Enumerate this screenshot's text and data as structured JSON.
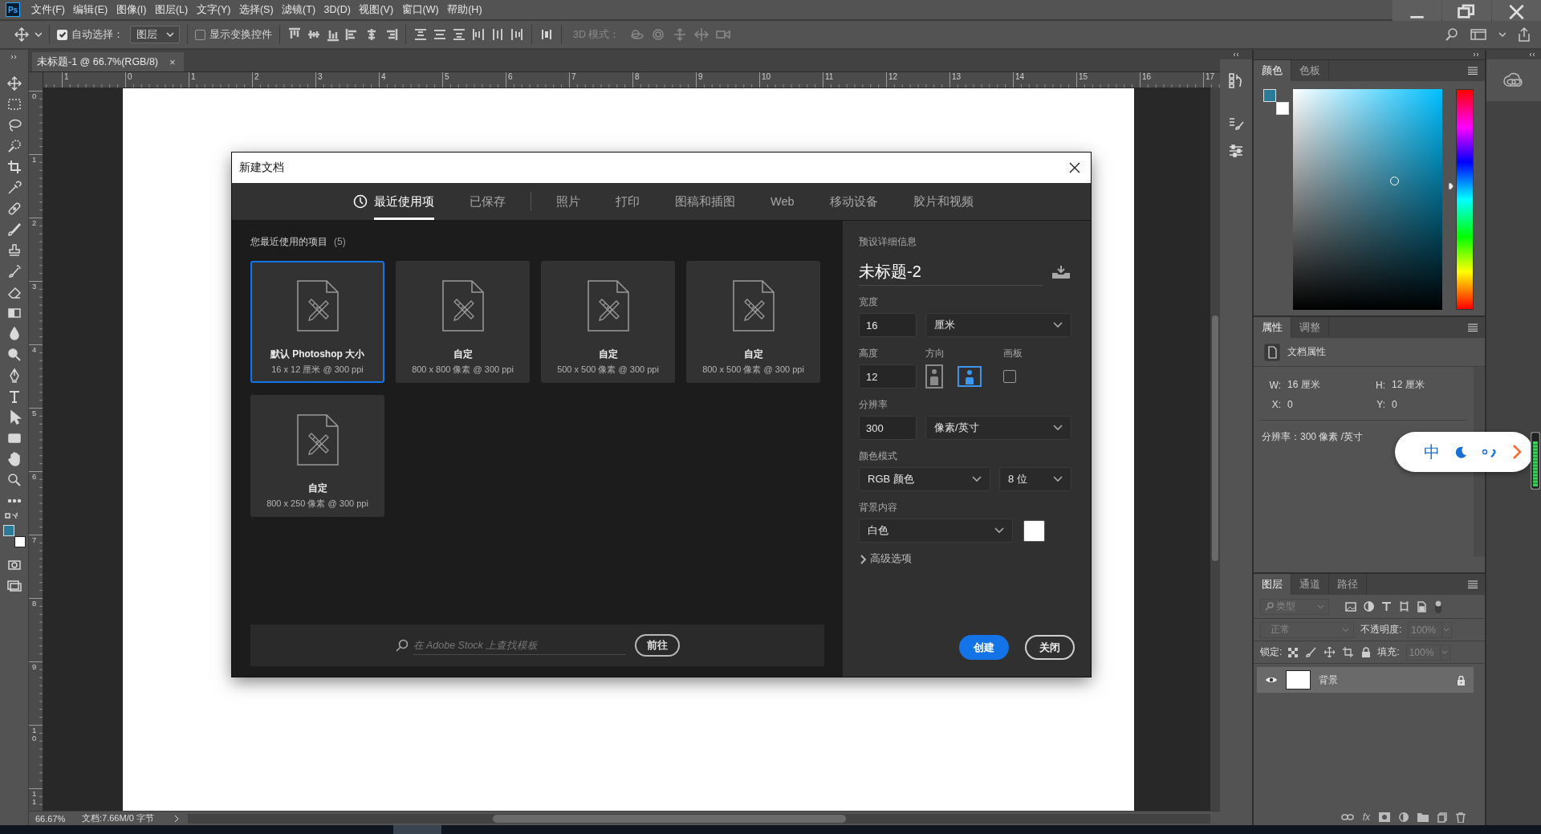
{
  "app": {
    "logo": "Ps"
  },
  "menu": [
    "文件(F)",
    "编辑(E)",
    "图像(I)",
    "图层(L)",
    "文字(Y)",
    "选择(S)",
    "滤镜(T)",
    "3D(D)",
    "视图(V)",
    "窗口(W)",
    "帮助(H)"
  ],
  "options_bar": {
    "auto_select": {
      "label": "自动选择：",
      "checked": true
    },
    "auto_select_target": "图层",
    "show_transform": {
      "label": "显示变换控件",
      "checked": false
    },
    "mode_3d": {
      "label": "3D 模式：",
      "disabled": true
    }
  },
  "colors": {
    "foreground": {
      "color": "#2b7a97"
    },
    "background": {
      "color": "#ffffff"
    },
    "hue": {
      "level": 0.56
    }
  },
  "document_tab": {
    "title": "未标题-1 @ 66.7%(RGB/8)",
    "close": "×"
  },
  "rulers": {
    "horizontal": [
      "1",
      "0",
      "1",
      "2",
      "3",
      "4",
      "5",
      "6",
      "7",
      "8",
      "9",
      "10",
      "11",
      "12",
      "13",
      "14",
      "15",
      "16",
      "17"
    ],
    "vertical": [
      "0",
      "1",
      "2",
      "3",
      "4",
      "5",
      "6",
      "7",
      "8",
      "9",
      "10",
      "11"
    ]
  },
  "dialog": {
    "title": "新建文档",
    "tabs": [
      {
        "label": "最近使用项",
        "selected": true
      },
      {
        "label": "已保存",
        "selected": false
      },
      {
        "label": "照片",
        "selected": false
      },
      {
        "label": "打印",
        "selected": false
      },
      {
        "label": "图稿和插图",
        "selected": false
      },
      {
        "label": "Web",
        "selected": false
      },
      {
        "label": "移动设备",
        "selected": false
      },
      {
        "label": "胶片和视频",
        "selected": false
      }
    ],
    "recent": {
      "heading": "您最近使用的项目",
      "count": "(5)",
      "items": [
        {
          "name": "默认 Photoshop 大小",
          "size": "16 x 12 厘米 @ 300 ppi",
          "selected": true
        },
        {
          "name": "自定",
          "size": "800 x 800 像素 @ 300 ppi",
          "selected": false
        },
        {
          "name": "自定",
          "size": "500 x 500 像素 @ 300 ppi",
          "selected": false
        },
        {
          "name": "自定",
          "size": "800 x 500 像素 @ 300 ppi",
          "selected": false
        },
        {
          "name": "自定",
          "size": "800 x 250 像素 @ 300 ppi",
          "selected": false
        }
      ]
    },
    "stock_search": {
      "placeholder": "在 Adobe Stock 上查找模板",
      "button": "前往"
    },
    "details": {
      "heading": "预设详细信息",
      "name": "未标题-2",
      "width": {
        "label": "宽度",
        "value": "16",
        "unit": "厘米"
      },
      "height": {
        "label": "高度",
        "value": "12"
      },
      "orientation": {
        "label": "方向",
        "options": [
          {
            "kind": "portrait",
            "selected": false
          },
          {
            "kind": "landscape",
            "selected": true
          }
        ]
      },
      "artboard": {
        "label": "画板",
        "checked": false
      },
      "resolution": {
        "label": "分辨率",
        "value": "300",
        "unit": "像素/英寸"
      },
      "color_mode": {
        "label": "颜色模式",
        "mode": "RGB 颜色",
        "depth": "8 位"
      },
      "background": {
        "label": "背景内容",
        "value": "白色",
        "color": "#ffffff"
      },
      "advanced": {
        "label": "高级选项",
        "expanded": false
      }
    },
    "buttons": [
      {
        "label": "创建",
        "kind": "primary"
      },
      {
        "label": "关闭",
        "kind": "secondary"
      }
    ]
  },
  "panels": {
    "color": {
      "tabs": [
        {
          "label": "颜色",
          "selected": true
        },
        {
          "label": "色板",
          "selected": false
        }
      ]
    },
    "properties": {
      "tabs": [
        {
          "label": "属性",
          "selected": true
        },
        {
          "label": "调整",
          "selected": false
        }
      ],
      "title": "文档属性",
      "fields": [
        {
          "label": "W:",
          "value": "16 厘米"
        },
        {
          "label": "H:",
          "value": "12 厘米"
        },
        {
          "label": "X:",
          "value": "0"
        },
        {
          "label": "Y:",
          "value": "0"
        }
      ],
      "resolution": "分辨率：300 像素 /英寸"
    },
    "layers": {
      "tabs": [
        {
          "label": "图层",
          "selected": true
        },
        {
          "label": "通道",
          "selected": false
        },
        {
          "label": "路径",
          "selected": false
        }
      ],
      "filter": {
        "value": "类型",
        "disabled": true
      },
      "blend_mode": {
        "value": "正常",
        "disabled": true
      },
      "opacity": {
        "label": "不透明度:",
        "value": "100%",
        "disabled": true
      },
      "lock_label": "锁定:",
      "fill": {
        "label": "填充:",
        "value": "100%",
        "disabled": true
      },
      "layers": [
        {
          "name": "背景",
          "visible": true,
          "locked": true,
          "selected": true
        }
      ],
      "fx": "fx"
    }
  },
  "ime_toolbar": {
    "mode": "中"
  },
  "status_bar": {
    "zoom": "66.67%",
    "document_info": "文档:7.66M/0 字节"
  }
}
